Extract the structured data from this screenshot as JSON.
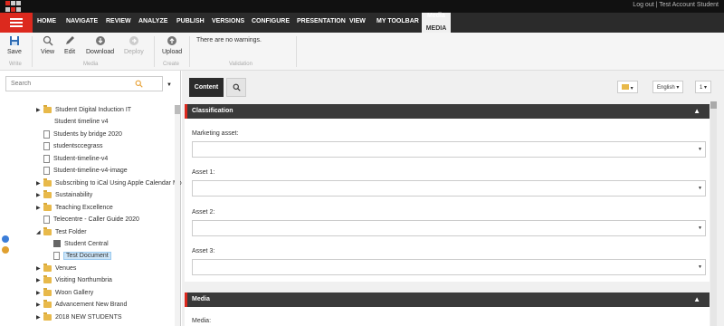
{
  "topbar": {
    "right_text": "Log out  |  Test Account Student"
  },
  "tabs": {
    "items": [
      "HOME",
      "NAVIGATE",
      "REVIEW",
      "ANALYZE",
      "PUBLISH",
      "VERSIONS",
      "CONFIGURE",
      "PRESENTATION",
      "VIEW",
      "MY TOOLBAR"
    ],
    "context_label": "Media",
    "active": "MEDIA"
  },
  "ribbon": {
    "save": "Save",
    "view": "View",
    "edit": "Edit",
    "download": "Download",
    "deploy": "Deploy",
    "upload": "Upload",
    "group_write": "Write",
    "group_media": "Media",
    "group_create": "Create",
    "group_validation": "Validation",
    "warnings": "There are no warnings."
  },
  "search": {
    "placeholder": "Search"
  },
  "tree": [
    {
      "label": "Student Digital Induction IT",
      "type": "folder",
      "arrow": "▶"
    },
    {
      "label": "Student timeline v4",
      "type": "none",
      "arrow": ""
    },
    {
      "label": "Students by bridge 2020",
      "type": "doc",
      "arrow": ""
    },
    {
      "label": "studentsccegrass",
      "type": "doc",
      "arrow": ""
    },
    {
      "label": "Student-timeline-v4",
      "type": "doc",
      "arrow": ""
    },
    {
      "label": "Student-timeline-v4-image",
      "type": "doc",
      "arrow": ""
    },
    {
      "label": "Subscribing to iCal Using Apple Calendar Mob",
      "type": "folder",
      "arrow": "▶"
    },
    {
      "label": "Sustainability",
      "type": "folder",
      "arrow": "▶"
    },
    {
      "label": "Teaching Excellence",
      "type": "folder",
      "arrow": "▶"
    },
    {
      "label": "Telecentre - Caller Guide 2020",
      "type": "doc",
      "arrow": ""
    },
    {
      "label": "Test Folder",
      "type": "folder",
      "arrow": "◢"
    },
    {
      "label": "Student Central",
      "type": "image",
      "arrow": ""
    },
    {
      "label": "Test Document",
      "type": "doc",
      "arrow": ""
    },
    {
      "label": "Venues",
      "type": "folder",
      "arrow": "▶"
    },
    {
      "label": "Visiting Northumbria",
      "type": "folder",
      "arrow": "▶"
    },
    {
      "label": "Woon Gallery",
      "type": "folder",
      "arrow": "▶"
    },
    {
      "label": "Advancement New Brand",
      "type": "folder",
      "arrow": "▶"
    },
    {
      "label": "2018 NEW STUDENTS",
      "type": "folder",
      "arrow": "▶"
    }
  ],
  "editor": {
    "content_tab": "Content",
    "language": "English",
    "version": "1",
    "section_classification": "Classification",
    "section_media": "Media",
    "fields": [
      {
        "label": "Marketing asset:"
      },
      {
        "label": "Asset 1:"
      },
      {
        "label": "Asset 2:"
      },
      {
        "label": "Asset 3:"
      }
    ],
    "media_label": "Media:"
  },
  "colors": {
    "accent": "#dc291e",
    "dark": "#2b2b2b",
    "folder": "#e8b94a"
  }
}
